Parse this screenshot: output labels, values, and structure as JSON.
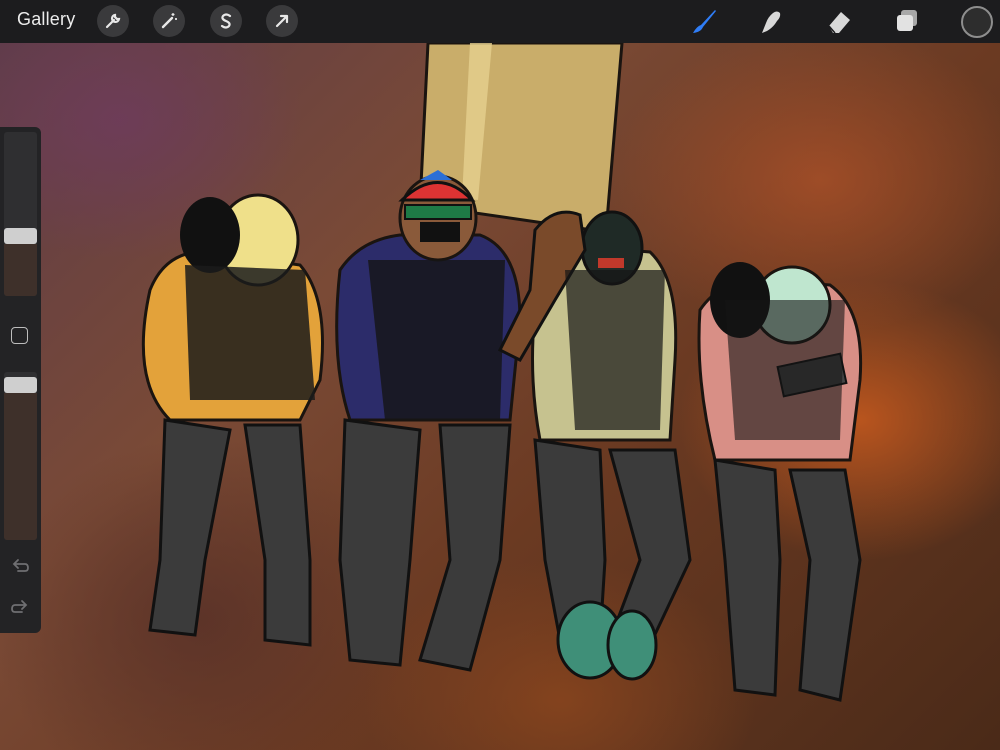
{
  "app": {
    "gallery_label": "Gallery"
  },
  "toolbar_left": [
    {
      "icon": "wrench-icon",
      "action": "actions"
    },
    {
      "icon": "magic-wand-icon",
      "action": "adjustments"
    },
    {
      "icon": "selection-s-icon",
      "action": "selection"
    },
    {
      "icon": "arrow-cursor-icon",
      "action": "transform"
    }
  ],
  "toolbar_right": [
    {
      "icon": "brush-icon",
      "action": "paint",
      "active": true
    },
    {
      "icon": "smudge-icon",
      "action": "smudge",
      "active": false
    },
    {
      "icon": "eraser-icon",
      "action": "erase",
      "active": false
    },
    {
      "icon": "layers-icon",
      "action": "layers",
      "active": false
    }
  ],
  "colors": {
    "accent": "#2f7df6",
    "current_color": "#2d2d2d",
    "toolbar_bg": "#1c1c1e",
    "sidebar_bg": "#232325"
  },
  "sidebar": {
    "brush_size_level": 0.35,
    "opacity_level": 0.97,
    "buttons": [
      "modify-square",
      "undo",
      "redo"
    ]
  }
}
